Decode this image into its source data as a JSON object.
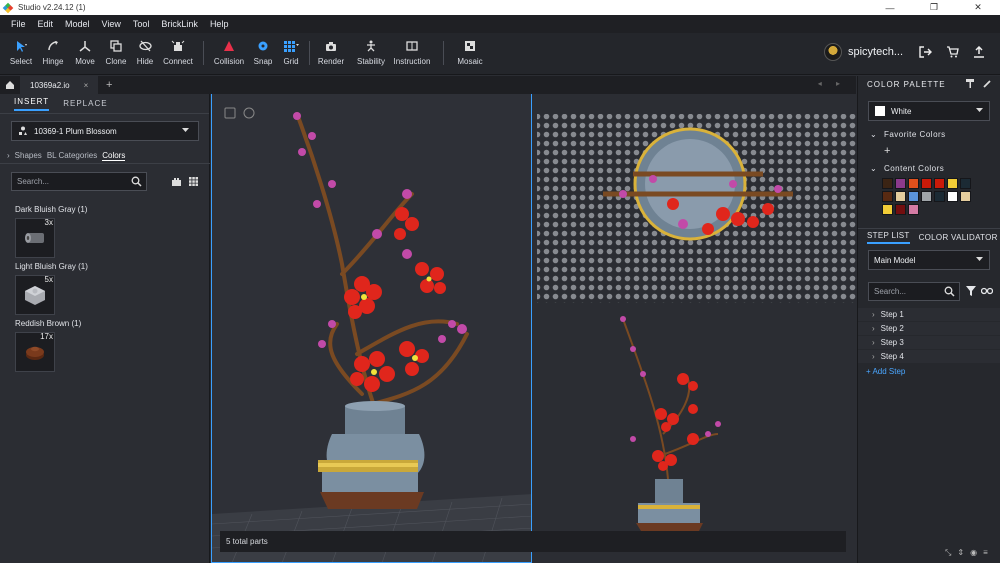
{
  "window": {
    "title": "Studio v2.24.12 (1)",
    "controls": [
      "—",
      "❐",
      "✕"
    ]
  },
  "menu": [
    "File",
    "Edit",
    "Model",
    "View",
    "Tool",
    "BrickLink",
    "Help"
  ],
  "toolbar": {
    "select": "Select",
    "hinge": "Hinge",
    "move": "Move",
    "clone": "Clone",
    "hide": "Hide",
    "connect": "Connect",
    "collision": "Collision",
    "snap": "Snap",
    "grid": "Grid",
    "render": "Render",
    "stability": "Stability",
    "instruction": "Instruction",
    "mosaic": "Mosaic"
  },
  "user": {
    "name": "spicytech..."
  },
  "tabs": {
    "file_name": "10369a2.io",
    "close": "×",
    "add": "+",
    "nav": "◂ ▸"
  },
  "left_panel": {
    "tabs": [
      "INSERT",
      "REPLACE"
    ],
    "set_name": "10369-1 Plum Blossom",
    "category_tabs": [
      "Shapes",
      "BL Categories",
      "Colors"
    ],
    "search_placeholder": "Search...",
    "groups": [
      {
        "name": "Dark Bluish Gray (1)",
        "qty": "3x",
        "color": "#6b6e74"
      },
      {
        "name": "Light Bluish Gray (1)",
        "qty": "5x",
        "color": "#a9abb1"
      },
      {
        "name": "Reddish Brown (1)",
        "qty": "17x",
        "color": "#7a3a1c"
      }
    ]
  },
  "status": {
    "text": "5 total parts"
  },
  "right_panel": {
    "palette_title": "COLOR PALETTE",
    "selected_color": "White",
    "favorite_colors": "Favorite Colors",
    "add_favorite": "+",
    "content_colors": "Content Colors",
    "swatches": [
      "#3b2414",
      "#8c3a8c",
      "#e0501c",
      "#c91a09",
      "#c91a09",
      "#f2cd37",
      "#1b2a34",
      "#582a12",
      "#e4cd9e",
      "#5a93db",
      "#a0a5a9",
      "#1b2a34",
      "#ffffff",
      "#e4cd9e",
      "#f2cd37",
      "#720e0f",
      "#d47ba4"
    ],
    "step_tabs": [
      "STEP LIST",
      "COLOR VALIDATOR"
    ],
    "model": "Main Model",
    "search_placeholder": "Search...",
    "steps": [
      "Step 1",
      "Step 2",
      "Step 3",
      "Step 4"
    ],
    "add_step": "+ Add Step"
  }
}
